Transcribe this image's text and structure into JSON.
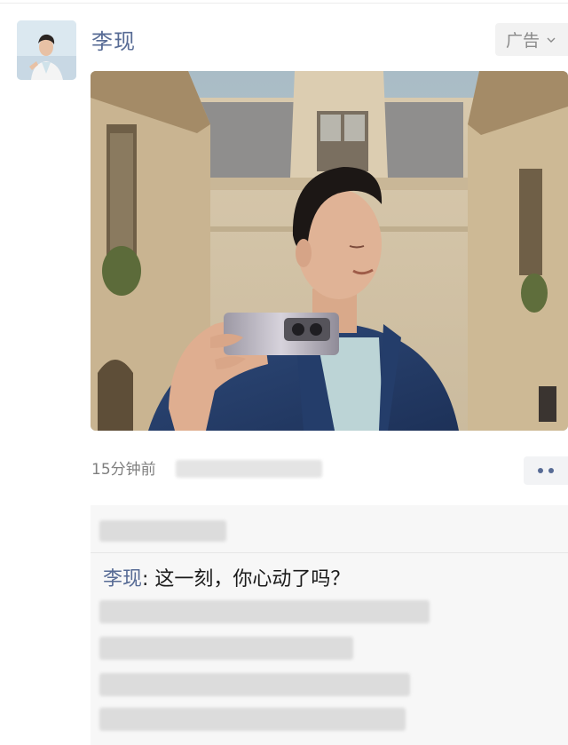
{
  "post": {
    "author": "李现",
    "ad_label": "广告",
    "time_ago": "15分钟前"
  },
  "comments": [
    {
      "author": "李现",
      "separator": ": ",
      "text": "这一刻，你心动了吗？"
    }
  ],
  "colors": {
    "link_blue": "#576b95",
    "comment_bg": "#f7f7f7",
    "ad_bg": "#f2f2f2"
  },
  "icons": {
    "ad_chevron": "chevron-down-icon",
    "more": "more-dots-icon"
  }
}
